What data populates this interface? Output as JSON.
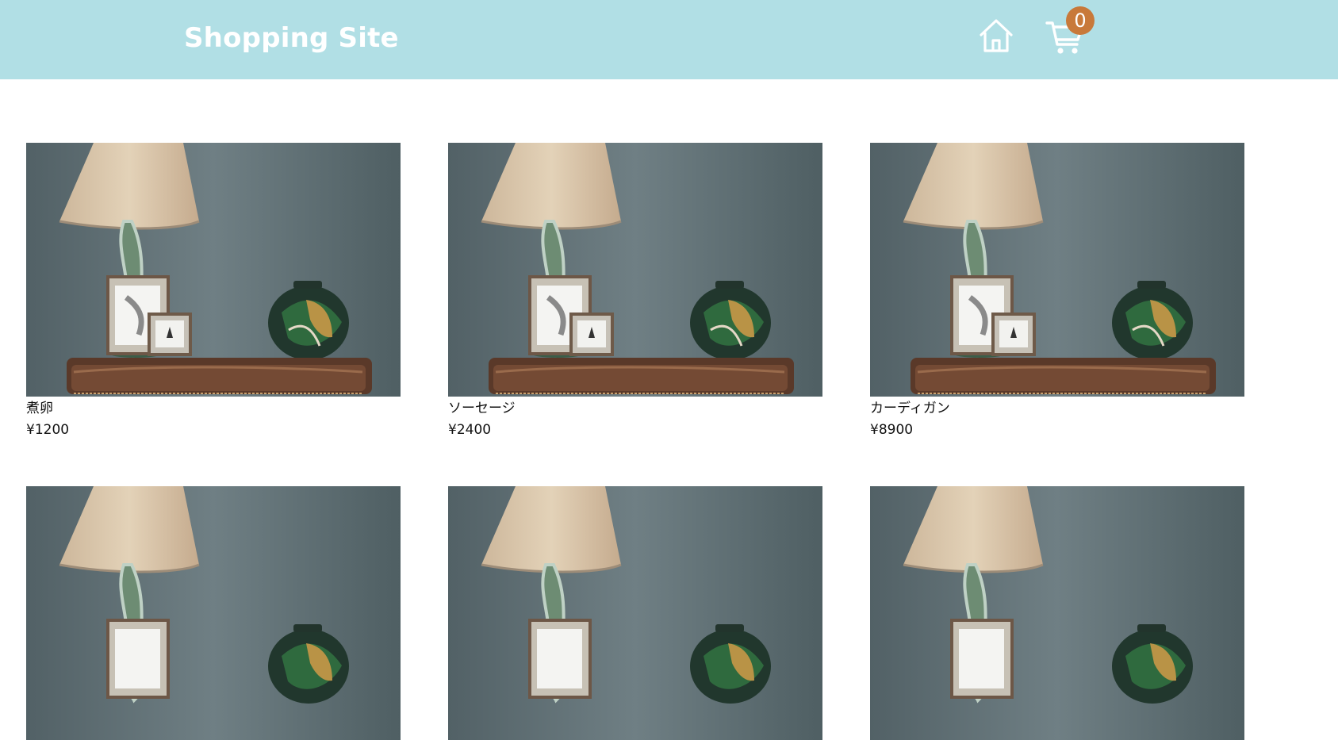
{
  "header": {
    "title": "Shopping Site",
    "background": "#b1dfe5",
    "home_icon": "home-icon",
    "cart_icon": "cart-icon",
    "cart_count": "0",
    "cart_badge_color": "#c8793a"
  },
  "products": [
    {
      "name": "煮卵",
      "price": "¥1200",
      "image": "lamp-vase-photo"
    },
    {
      "name": "ソーセージ",
      "price": "¥2400",
      "image": "lamp-vase-photo"
    },
    {
      "name": "カーディガン",
      "price": "¥8900",
      "image": "lamp-vase-photo"
    },
    {
      "name": "",
      "price": "",
      "image": "lamp-vase-photo"
    },
    {
      "name": "",
      "price": "",
      "image": "lamp-vase-photo"
    },
    {
      "name": "",
      "price": "",
      "image": "lamp-vase-photo"
    }
  ]
}
